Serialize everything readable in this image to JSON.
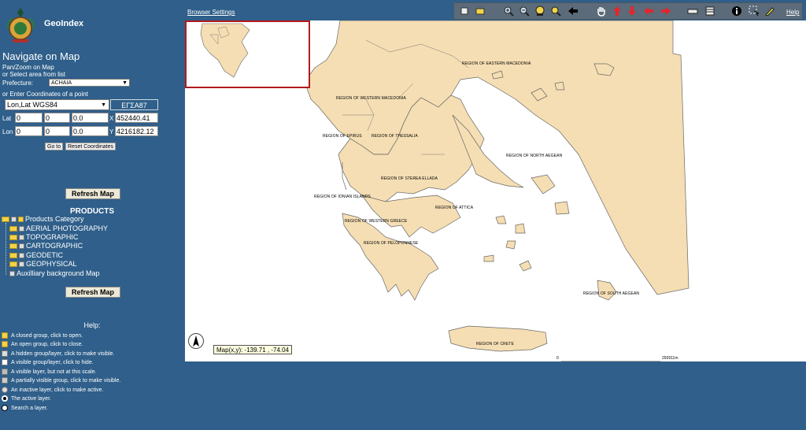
{
  "app": {
    "title": "GeoIndex"
  },
  "navigate": {
    "title": "Navigate on Map",
    "line1": "Pan/Zoom on Map",
    "line2": "or Select area from list",
    "prefecture_label": "Prefecture:",
    "prefecture_value": "ACHAIA",
    "coords_label": "or Enter Coordinates of a point",
    "crs_value": "Lon,Lat WGS84",
    "egsa_label": "ΕΓΣΑ87",
    "lat_label": "Lat",
    "lon_label": "Lon",
    "lat_deg": "0",
    "lat_min": "0",
    "lat_sec": "0.0",
    "lon_deg": "0",
    "lon_min": "0",
    "lon_sec": "0.0",
    "x_label": "X",
    "y_label": "Y",
    "x_value": "452440.41",
    "y_value": "4216182.12",
    "goto_label": "Go to",
    "reset_label": "Reset Coordinates"
  },
  "refresh_label": "Refresh Map",
  "products": {
    "title": "PRODUCTS",
    "root": "Products Category",
    "items": [
      "AERIAL PHOTOGRAPHY",
      "TOPOGRAPHIC",
      "CARTOGRAPHIC",
      "GEODETIC",
      "GEOPHYSICAL"
    ],
    "background": "Auxilliary background Map"
  },
  "help": {
    "title": "Help:",
    "items": [
      "A closed group, click to open.",
      "An open group, click to close.",
      "A hidden group/layer, click to make visible.",
      "A visible group/layer, click to hide.",
      "A visible layer, but not at this scale.",
      "A partially visible group, click to make visible.",
      "An inactive layer, click to make active.",
      "The active layer.",
      "Search a layer."
    ]
  },
  "topbar": {
    "browser_settings": "Browser Settings",
    "help": "Help"
  },
  "toolbar_icons": [
    "select-icon",
    "rubber-band-icon",
    "zoom-in-icon",
    "zoom-out-icon",
    "zoom-full-icon",
    "zoom-search-icon",
    "back-icon",
    "pan-hand-icon",
    "pan-up-icon",
    "pan-down-icon",
    "pan-left-icon",
    "pan-right-icon",
    "measure-icon",
    "layers-icon",
    "info-icon",
    "select-area-icon",
    "highlight-icon"
  ],
  "map": {
    "regions": [
      "REGION OF EASTERN MACEDONIA",
      "REGION OF WESTERN MACEDONIA",
      "REGION OF EPIRUS",
      "REGION OF THESSALIA",
      "REGION OF NORTH AEGEAN",
      "REGION OF STEREA ELLADA",
      "REGION OF IONIAN ISLANDS",
      "REGION OF ATTICA",
      "REGION OF WESTERN GREECE",
      "REGION OF PELOPONNESE",
      "REGION OF SOUTH AEGEAN",
      "REGION OF CRETE"
    ],
    "coord_readout": "Map(x,y): -139.71 , -74.04",
    "scale_start": "0",
    "scale_end": "293911m"
  },
  "colors": {
    "land": "#f5deb3",
    "sea": "#ffffff",
    "panel": "#2f5f8a",
    "border": "#555555"
  }
}
